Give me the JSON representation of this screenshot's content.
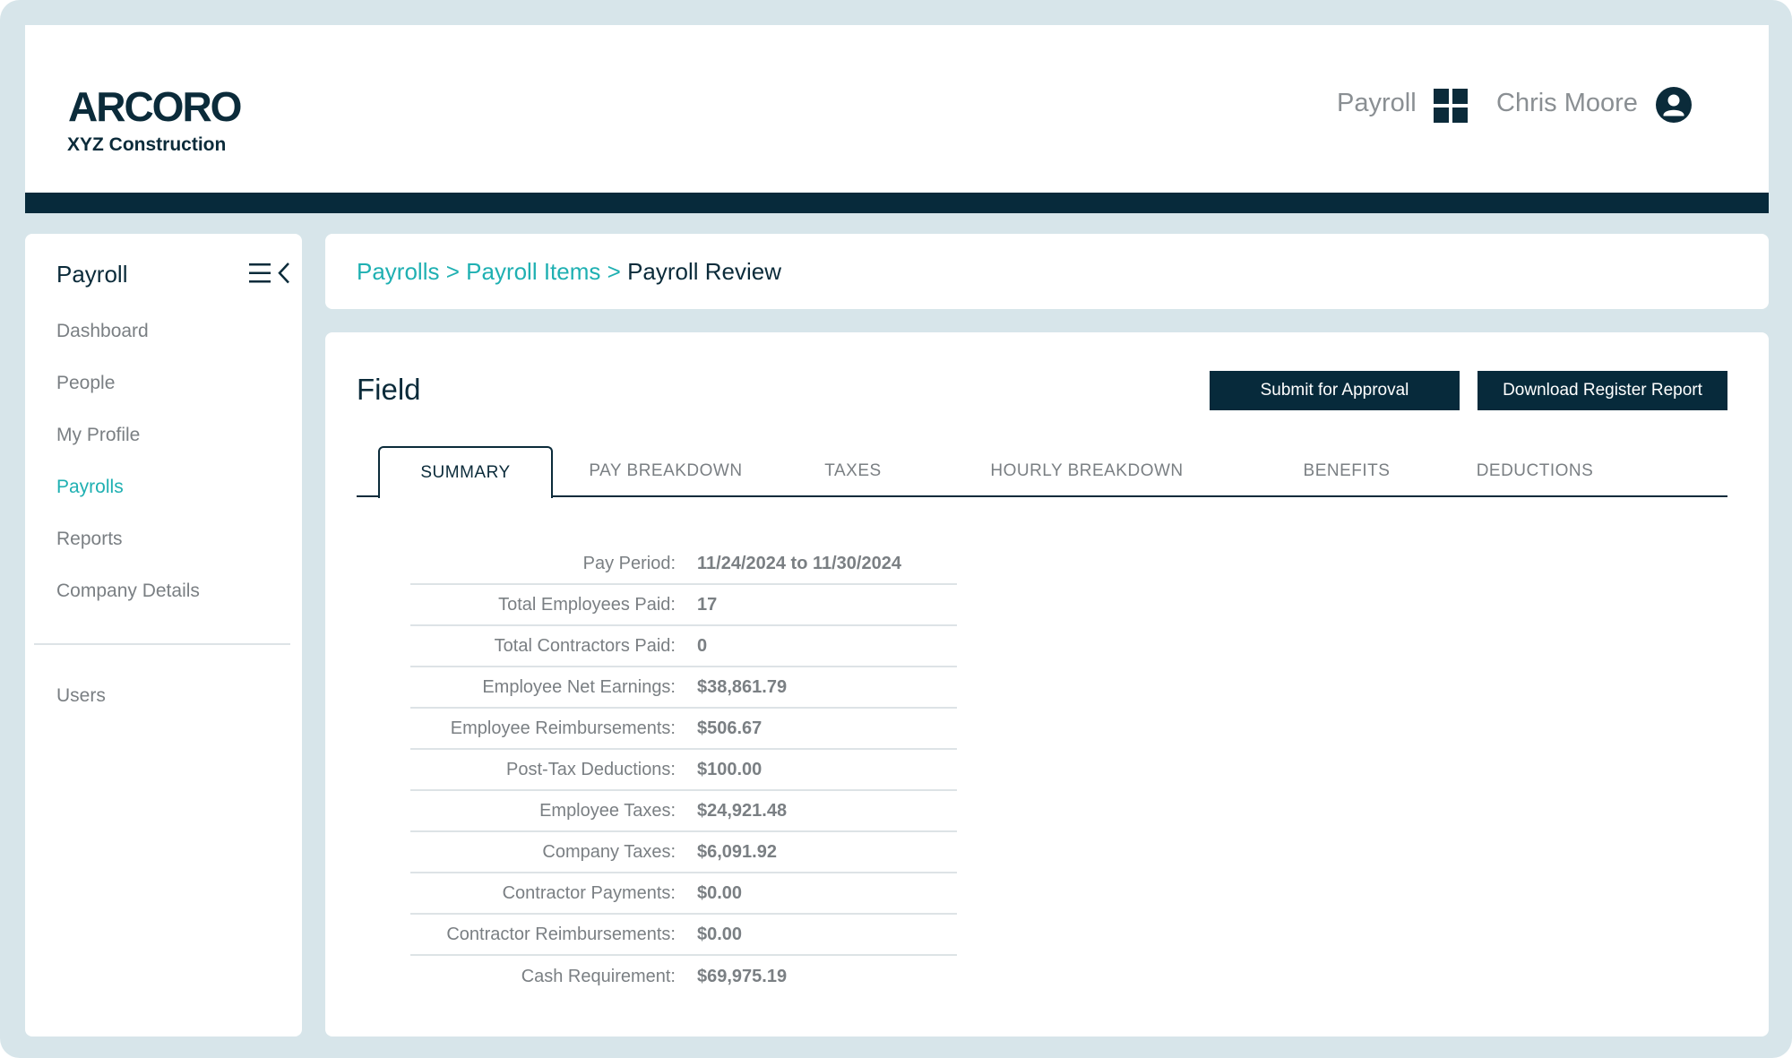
{
  "header": {
    "logo_text": "ARCORO",
    "company_name": "XYZ Construction",
    "app_name": "Payroll",
    "app_switcher_icon": "grid-icon",
    "user_name": "Chris Moore",
    "user_icon": "user-circle-icon"
  },
  "sidebar": {
    "title": "Payroll",
    "collapse_icon": "menu-collapse-icon",
    "items": [
      {
        "label": "Dashboard",
        "active": false
      },
      {
        "label": "People",
        "active": false
      },
      {
        "label": "My Profile",
        "active": false
      },
      {
        "label": "Payrolls",
        "active": true
      },
      {
        "label": "Reports",
        "active": false
      },
      {
        "label": "Company Details",
        "active": false
      }
    ],
    "secondary_items": [
      {
        "label": "Users",
        "active": false
      }
    ]
  },
  "breadcrumb": {
    "items": [
      "Payrolls",
      "Payroll Items"
    ],
    "separator": ">",
    "current": "Payroll Review"
  },
  "main": {
    "title": "Field",
    "actions": {
      "submit_label": "Submit for Approval",
      "download_label": "Download Register Report"
    },
    "tabs": [
      {
        "label": "SUMMARY",
        "active": true
      },
      {
        "label": "PAY BREAKDOWN",
        "active": false
      },
      {
        "label": "TAXES",
        "active": false
      },
      {
        "label": "HOURLY BREAKDOWN",
        "active": false
      },
      {
        "label": "BENEFITS",
        "active": false
      },
      {
        "label": "DEDUCTIONS",
        "active": false
      }
    ],
    "summary": [
      {
        "label": "Pay Period:",
        "value": "11/24/2024 to 11/30/2024"
      },
      {
        "label": "Total Employees Paid:",
        "value": "17"
      },
      {
        "label": "Total Contractors Paid:",
        "value": "0"
      },
      {
        "label": "Employee Net Earnings:",
        "value": "$38,861.79"
      },
      {
        "label": "Employee Reimbursements:",
        "value": "$506.67"
      },
      {
        "label": "Post-Tax Deductions:",
        "value": "$100.00"
      },
      {
        "label": "Employee Taxes:",
        "value": "$24,921.48"
      },
      {
        "label": "Company Taxes:",
        "value": "$6,091.92"
      },
      {
        "label": "Contractor Payments:",
        "value": "$0.00"
      },
      {
        "label": "Contractor Reimbursements:",
        "value": "$0.00"
      },
      {
        "label": "Cash Requirement:",
        "value": "$69,975.19"
      }
    ]
  },
  "colors": {
    "brand_dark": "#072a3b",
    "accent_teal": "#1fb0b2",
    "frame_bg": "#d7e5ea",
    "muted_text": "#7a7f83"
  }
}
